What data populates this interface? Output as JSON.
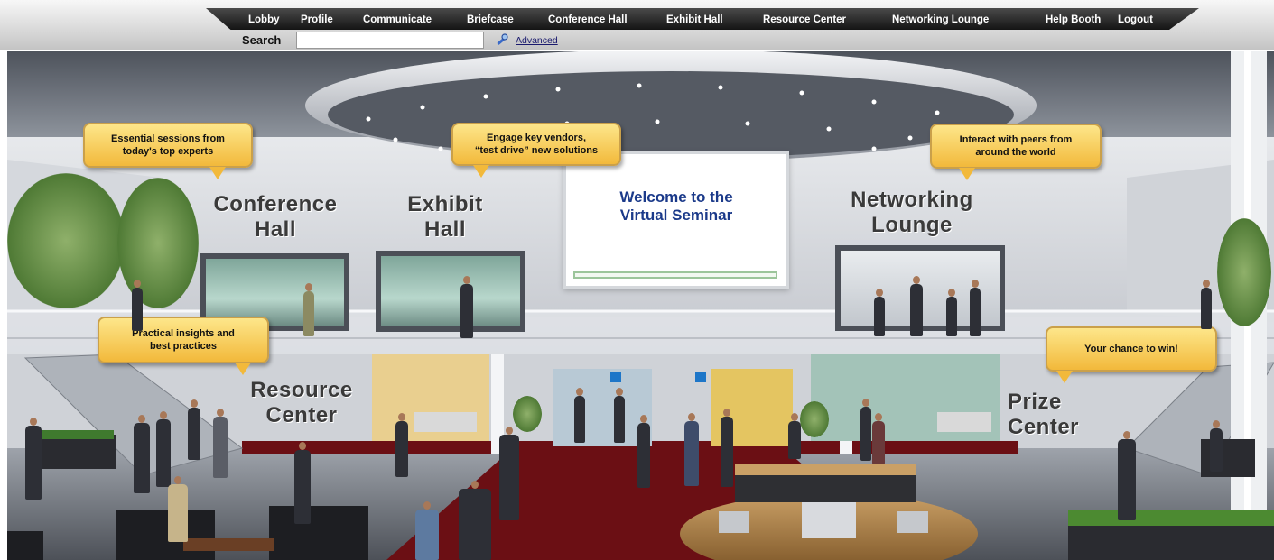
{
  "nav": {
    "items": [
      "Lobby",
      "Profile",
      "Communicate",
      "Briefcase",
      "Conference Hall",
      "Exhibit Hall",
      "Resource Center",
      "Networking Lounge",
      "Help Booth",
      "Logout"
    ]
  },
  "search": {
    "label": "Search",
    "value": "",
    "advanced_label": "Advanced",
    "icon": "search-icon"
  },
  "scene": {
    "welcome_line1": "Welcome to the",
    "welcome_line2": "Virtual Seminar",
    "areas": {
      "conference": [
        "Conference",
        "Hall"
      ],
      "exhibit": [
        "Exhibit",
        "Hall"
      ],
      "networking": [
        "Networking",
        "Lounge"
      ],
      "resource": [
        "Resource",
        "Center"
      ],
      "prize": [
        "Prize",
        "Center"
      ]
    },
    "bubbles": {
      "conference": [
        "Essential sessions from",
        "today's top experts"
      ],
      "exhibit": [
        "Engage key vendors,",
        "“test drive” new solutions"
      ],
      "networking": [
        "Interact with peers from",
        "around the world"
      ],
      "resource": [
        "Practical insights and",
        "best practices"
      ],
      "prize": [
        "Your chance to win!"
      ]
    }
  },
  "colors": {
    "bubble": "#f2b93b",
    "welcome_text": "#1b3a8a",
    "carpet": "#6b0f14"
  }
}
